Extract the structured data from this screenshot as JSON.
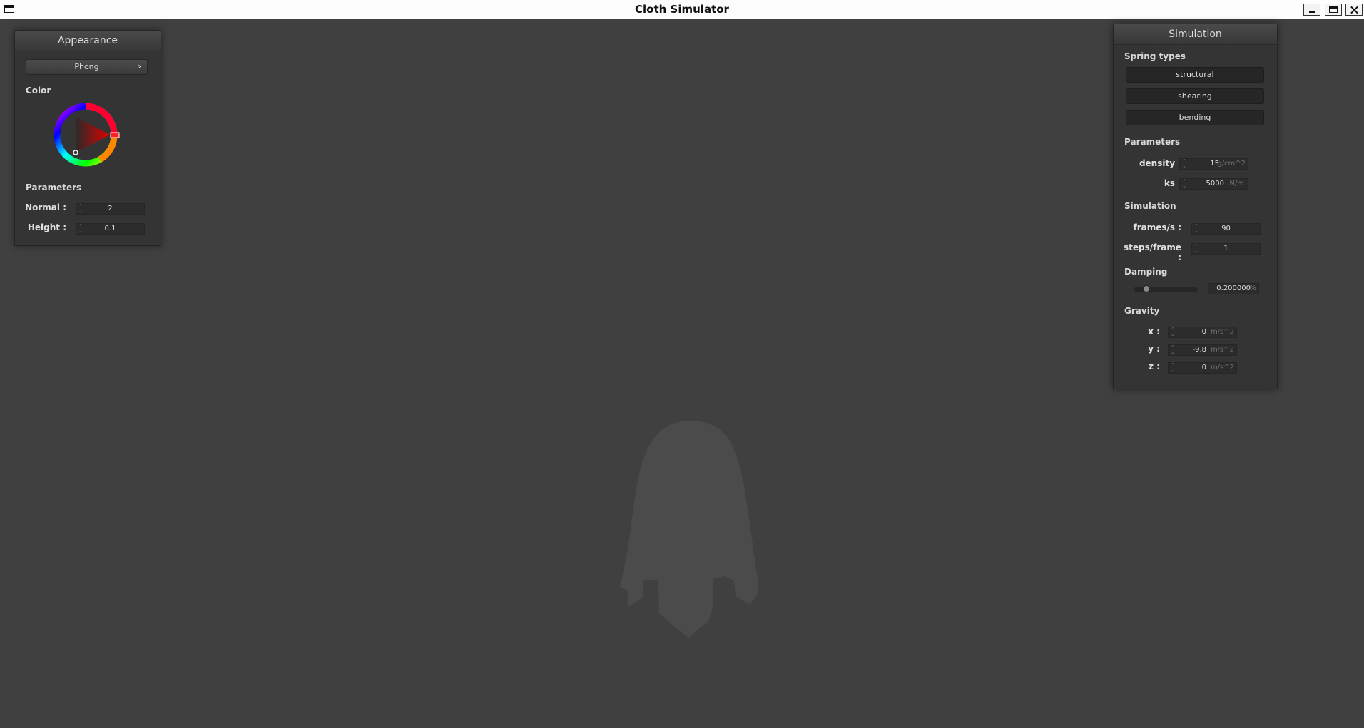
{
  "window": {
    "title": "Cloth Simulator"
  },
  "appearance": {
    "header": "Appearance",
    "shading_mode": "Phong",
    "color_label": "Color",
    "color_value": "#ff0000",
    "parameters_label": "Parameters",
    "normal_label": "Normal :",
    "normal_value": "2",
    "height_label": "Height :",
    "height_value": "0.1"
  },
  "simulation": {
    "header": "Simulation",
    "spring_types_label": "Spring types",
    "spring_types": [
      "structural",
      "shearing",
      "bending"
    ],
    "parameters_label": "Parameters",
    "density_label": "density :",
    "density_value": "15",
    "density_unit": "g/cm^2",
    "ks_label": "ks :",
    "ks_value": "5000",
    "ks_unit": "N/m",
    "simulation_label": "Simulation",
    "fps_label": "frames/s :",
    "fps_value": "90",
    "steps_label": "steps/frame :",
    "steps_value": "1",
    "damping_label": "Damping",
    "damping_value": "0.200000",
    "damping_unit": "%",
    "damping_slider_fraction": 0.2,
    "gravity_label": "Gravity",
    "gx_label": "x :",
    "gx_value": "0",
    "gy_label": "y :",
    "gy_value": "-9.8",
    "gz_label": "z :",
    "gz_value": "0",
    "gravity_unit": "m/s^2"
  },
  "colors": {
    "background": "#404040",
    "panel": "#343434",
    "cloth": "#4a4a4a"
  }
}
